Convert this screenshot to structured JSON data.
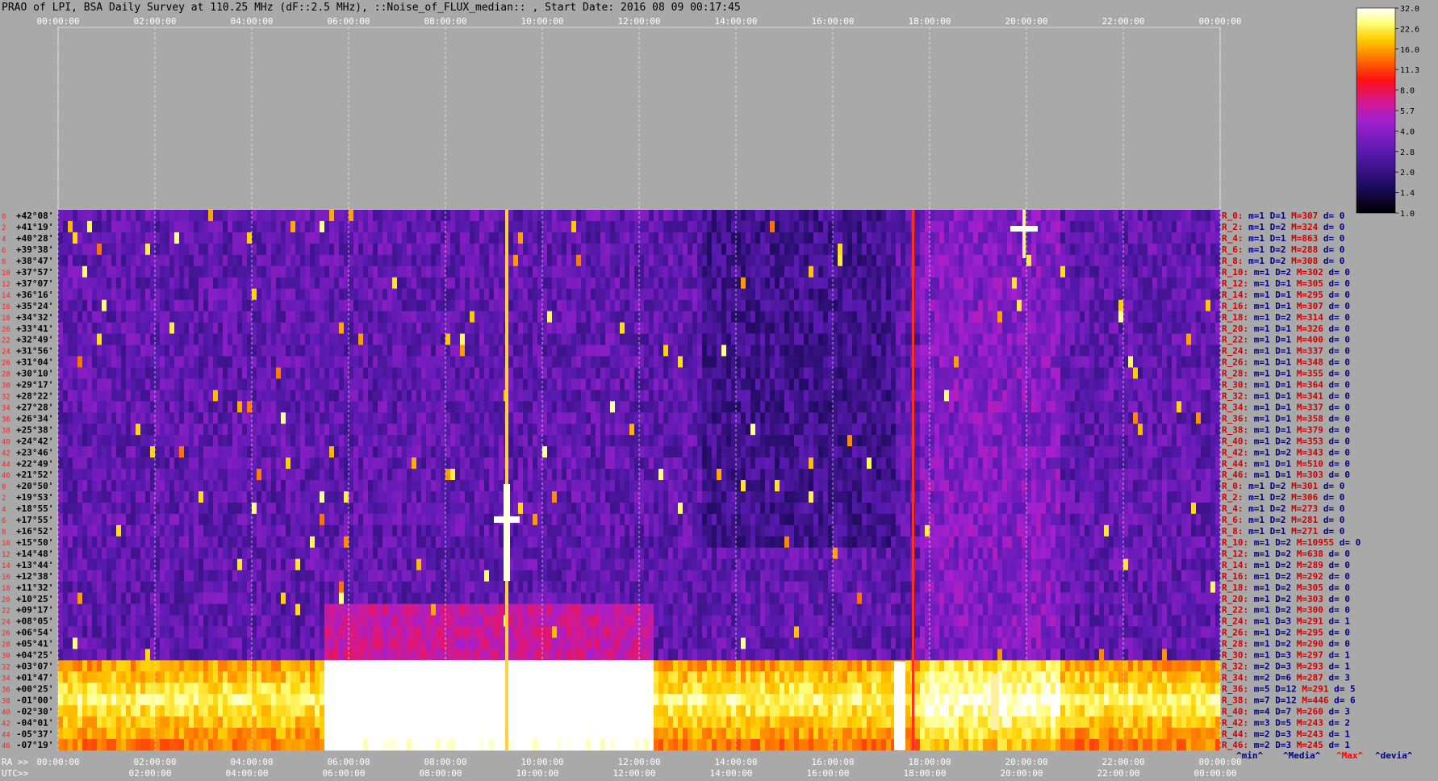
{
  "title": "PRAO of LPI, BSA Daily Survey at 110.25 MHz (dF::2.5 MHz), ::Noise_of_FLUX_median:: , Start Date: 2016 08 09 00:17:45",
  "colors": {
    "bg": "#a9a9a9",
    "stat_label": "#d00000",
    "stat_text": "#000080",
    "header_max": "#ff0000"
  },
  "colorbar": {
    "ticks": [
      "32.0",
      "22.6",
      "16.0",
      "11.3",
      "8.0",
      "5.7",
      "4.0",
      "2.8",
      "2.0",
      "1.4",
      "1.0"
    ]
  },
  "chart_data": {
    "type": "heatmap",
    "x_top_ticks": [
      "00:00:00",
      "02:00:00",
      "04:00:00",
      "06:00:00",
      "08:00:00",
      "10:00:00",
      "12:00:00",
      "14:00:00",
      "16:00:00",
      "18:00:00",
      "20:00:00",
      "22:00:00",
      "00:00:00"
    ],
    "x_bottom_prefix": "RA >>",
    "x_bottom_ticks": [
      "00:00:00",
      "02:00:00",
      "04:00:00",
      "06:00:00",
      "08:00:00",
      "10:00:00",
      "12:00:00",
      "14:00:00",
      "16:00:00",
      "18:00:00",
      "20:00:00",
      "22:00:00",
      "00:00:00"
    ],
    "utc_prefix": "UTC>>",
    "utc_ticks": [
      "02:00:00",
      "04:00:00",
      "06:00:00",
      "08:00:00",
      "10:00:00",
      "12:00:00",
      "14:00:00",
      "16:00:00",
      "18:00:00",
      "20:00:00",
      "22:00:00",
      "00:00:00"
    ],
    "y_labels": [
      "+42°08'",
      "+41°19'",
      "+40°28'",
      "+39°38'",
      "+38°47'",
      "+37°57'",
      "+37°07'",
      "+36°16'",
      "+35°24'",
      "+34°32'",
      "+33°41'",
      "+32°49'",
      "+31°56'",
      "+31°04'",
      "+30°10'",
      "+29°17'",
      "+28°22'",
      "+27°28'",
      "+26°34'",
      "+25°38'",
      "+24°42'",
      "+23°46'",
      "+22°49'",
      "+21°52'",
      "+20°50'",
      "+19°53'",
      "+18°55'",
      "+17°55'",
      "+16°52'",
      "+15°50'",
      "+14°48'",
      "+13°44'",
      "+12°38'",
      "+11°32'",
      "+10°25'",
      "+09°17'",
      "+08°05'",
      "+06°54'",
      "+05°41'",
      "+04°25'",
      "+03°07'",
      "+01°47'",
      "+00°25'",
      "-01°00'",
      "-02°30'",
      "-04°01'",
      "-05°37'",
      "-07°19'"
    ],
    "row_numbers": [
      "0",
      "2",
      "4",
      "6",
      "8",
      "10",
      "12",
      "14",
      "16",
      "18",
      "20",
      "22",
      "24",
      "26",
      "28",
      "30",
      "32",
      "34",
      "36",
      "38",
      "40",
      "42",
      "44",
      "46",
      "0",
      "2",
      "4",
      "6",
      "8",
      "10",
      "12",
      "14",
      "16",
      "18",
      "20",
      "22",
      "24",
      "26",
      "28",
      "30",
      "32",
      "34",
      "36",
      "38",
      "40",
      "42",
      "44",
      "46"
    ],
    "stats_header": [
      "^min^",
      "^Media^",
      "^Max^",
      "^devia^"
    ],
    "stats": [
      {
        "r": "R_0:",
        "m": "m=1",
        "D": "D=1",
        "M": "M=307",
        "d": "d= 0"
      },
      {
        "r": "R_2:",
        "m": "m=1",
        "D": "D=2",
        "M": "M=324",
        "d": "d= 0"
      },
      {
        "r": "R_4:",
        "m": "m=1",
        "D": "D=1",
        "M": "M=863",
        "d": "d= 0"
      },
      {
        "r": "R_6:",
        "m": "m=1",
        "D": "D=2",
        "M": "M=288",
        "d": "d= 0"
      },
      {
        "r": "R_8:",
        "m": "m=1",
        "D": "D=2",
        "M": "M=308",
        "d": "d= 0"
      },
      {
        "r": "R_10:",
        "m": "m=1",
        "D": "D=2",
        "M": "M=302",
        "d": "d= 0"
      },
      {
        "r": "R_12:",
        "m": "m=1",
        "D": "D=1",
        "M": "M=305",
        "d": "d= 0"
      },
      {
        "r": "R_14:",
        "m": "m=1",
        "D": "D=1",
        "M": "M=295",
        "d": "d= 0"
      },
      {
        "r": "R_16:",
        "m": "m=1",
        "D": "D=1",
        "M": "M=307",
        "d": "d= 0"
      },
      {
        "r": "R_18:",
        "m": "m=1",
        "D": "D=2",
        "M": "M=314",
        "d": "d= 0"
      },
      {
        "r": "R_20:",
        "m": "m=1",
        "D": "D=1",
        "M": "M=326",
        "d": "d= 0"
      },
      {
        "r": "R_22:",
        "m": "m=1",
        "D": "D=1",
        "M": "M=400",
        "d": "d= 0"
      },
      {
        "r": "R_24:",
        "m": "m=1",
        "D": "D=1",
        "M": "M=337",
        "d": "d= 0"
      },
      {
        "r": "R_26:",
        "m": "m=1",
        "D": "D=1",
        "M": "M=348",
        "d": "d= 0"
      },
      {
        "r": "R_28:",
        "m": "m=1",
        "D": "D=1",
        "M": "M=355",
        "d": "d= 0"
      },
      {
        "r": "R_30:",
        "m": "m=1",
        "D": "D=1",
        "M": "M=364",
        "d": "d= 0"
      },
      {
        "r": "R_32:",
        "m": "m=1",
        "D": "D=1",
        "M": "M=341",
        "d": "d= 0"
      },
      {
        "r": "R_34:",
        "m": "m=1",
        "D": "D=1",
        "M": "M=337",
        "d": "d= 0"
      },
      {
        "r": "R_36:",
        "m": "m=1",
        "D": "D=1",
        "M": "M=358",
        "d": "d= 0"
      },
      {
        "r": "R_38:",
        "m": "m=1",
        "D": "D=1",
        "M": "M=379",
        "d": "d= 0"
      },
      {
        "r": "R_40:",
        "m": "m=1",
        "D": "D=2",
        "M": "M=353",
        "d": "d= 0"
      },
      {
        "r": "R_42:",
        "m": "m=1",
        "D": "D=2",
        "M": "M=343",
        "d": "d= 0"
      },
      {
        "r": "R_44:",
        "m": "m=1",
        "D": "D=1",
        "M": "M=510",
        "d": "d= 0"
      },
      {
        "r": "R_46:",
        "m": "m=1",
        "D": "D=1",
        "M": "M=303",
        "d": "d= 0"
      },
      {
        "r": "R_0:",
        "m": "m=1",
        "D": "D=2",
        "M": "M=301",
        "d": "d= 0"
      },
      {
        "r": "R_2:",
        "m": "m=1",
        "D": "D=2",
        "M": "M=306",
        "d": "d= 0"
      },
      {
        "r": "R_4:",
        "m": "m=1",
        "D": "D=2",
        "M": "M=273",
        "d": "d= 0"
      },
      {
        "r": "R_6:",
        "m": "m=1",
        "D": "D=2",
        "M": "M=281",
        "d": "d= 0"
      },
      {
        "r": "R_8:",
        "m": "m=1",
        "D": "D=1",
        "M": "M=271",
        "d": "d= 0"
      },
      {
        "r": "R_10:",
        "m": "m=1",
        "D": "D=2",
        "M": "M=10955",
        "d": "d= 0"
      },
      {
        "r": "R_12:",
        "m": "m=1",
        "D": "D=2",
        "M": "M=638",
        "d": "d= 0"
      },
      {
        "r": "R_14:",
        "m": "m=1",
        "D": "D=2",
        "M": "M=289",
        "d": "d= 0"
      },
      {
        "r": "R_16:",
        "m": "m=1",
        "D": "D=2",
        "M": "M=292",
        "d": "d= 0"
      },
      {
        "r": "R_18:",
        "m": "m=1",
        "D": "D=2",
        "M": "M=305",
        "d": "d= 0"
      },
      {
        "r": "R_20:",
        "m": "m=1",
        "D": "D=2",
        "M": "M=303",
        "d": "d= 0"
      },
      {
        "r": "R_22:",
        "m": "m=1",
        "D": "D=2",
        "M": "M=300",
        "d": "d= 0"
      },
      {
        "r": "R_24:",
        "m": "m=1",
        "D": "D=3",
        "M": "M=291",
        "d": "d= 1"
      },
      {
        "r": "R_26:",
        "m": "m=1",
        "D": "D=2",
        "M": "M=295",
        "d": "d= 0"
      },
      {
        "r": "R_28:",
        "m": "m=1",
        "D": "D=2",
        "M": "M=290",
        "d": "d= 0"
      },
      {
        "r": "R_30:",
        "m": "m=1",
        "D": "D=3",
        "M": "M=297",
        "d": "d= 1"
      },
      {
        "r": "R_32:",
        "m": "m=2",
        "D": "D=3",
        "M": "M=293",
        "d": "d= 1"
      },
      {
        "r": "R_34:",
        "m": "m=2",
        "D": "D=6",
        "M": "M=287",
        "d": "d= 3"
      },
      {
        "r": "R_36:",
        "m": "m=5",
        "D": "D=12",
        "M": "M=291",
        "d": "d= 5"
      },
      {
        "r": "R_38:",
        "m": "m=7",
        "D": "D=12",
        "M": "M=446",
        "d": "d= 6"
      },
      {
        "r": "R_40:",
        "m": "m=4",
        "D": "D=7",
        "M": "M=260",
        "d": "d= 3"
      },
      {
        "r": "R_42:",
        "m": "m=3",
        "D": "D=5",
        "M": "M=243",
        "d": "d= 2"
      },
      {
        "r": "R_44:",
        "m": "m=2",
        "D": "D=3",
        "M": "M=243",
        "d": "d= 1"
      },
      {
        "r": "R_46:",
        "m": "m=2",
        "D": "D=3",
        "M": "M=245",
        "d": "d= 1"
      }
    ]
  }
}
